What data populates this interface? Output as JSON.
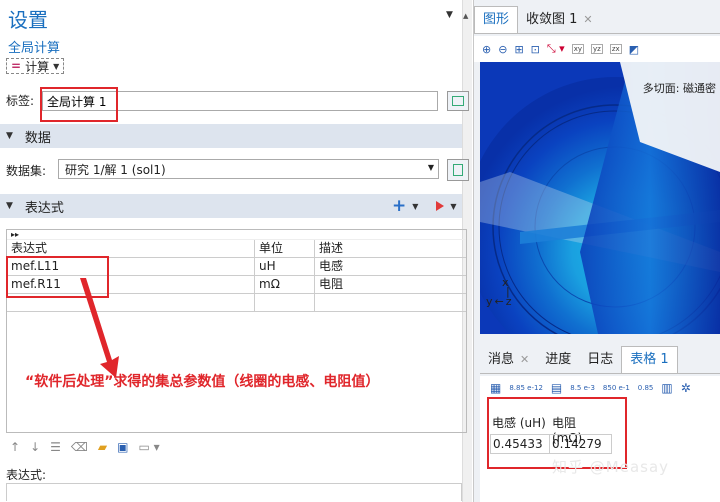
{
  "settings": {
    "title": "设置",
    "subtitle": "全局计算",
    "calc_button": "计算",
    "label_caption": "标签:",
    "label_value": "全局计算 1"
  },
  "sections": {
    "data": "数据",
    "expressions": "表达式"
  },
  "dataset": {
    "caption": "数据集:",
    "value": "研究 1/解 1 (sol1)"
  },
  "expr_table": {
    "headers": [
      "表达式",
      "单位",
      "描述"
    ],
    "rows": [
      [
        "mef.L11",
        "uH",
        "电感"
      ],
      [
        "mef.R11",
        "mΩ",
        "电阻"
      ]
    ]
  },
  "annotation": "“软件后处理”求得的集总参数值（线圈的电感、电阻值）",
  "expr_footer": "表达式:",
  "right_tabs": {
    "graphics": "图形",
    "convergence": "收敛图 1"
  },
  "viewport": {
    "multi_slice_label": "多切面: 磁通密",
    "axis_x": "x",
    "axis_y": "y",
    "axis_z": "z"
  },
  "bottom_tabs": {
    "messages": "消息",
    "progress": "进度",
    "log": "日志",
    "table": "表格 1"
  },
  "table_tool_labels": [
    "8.85 e-12",
    "8.5 e-3",
    "850 e-1",
    "0.85"
  ],
  "results": {
    "headers": [
      "电感 (uH)",
      "电阻 (mΩ)"
    ],
    "values": [
      "0.45433",
      "0.14279"
    ]
  },
  "watermark": "知乎 @Measay",
  "colors": {
    "accent_blue": "#1a6fbf",
    "highlight_red": "#e0262b",
    "section_bg": "#dde4ee"
  }
}
